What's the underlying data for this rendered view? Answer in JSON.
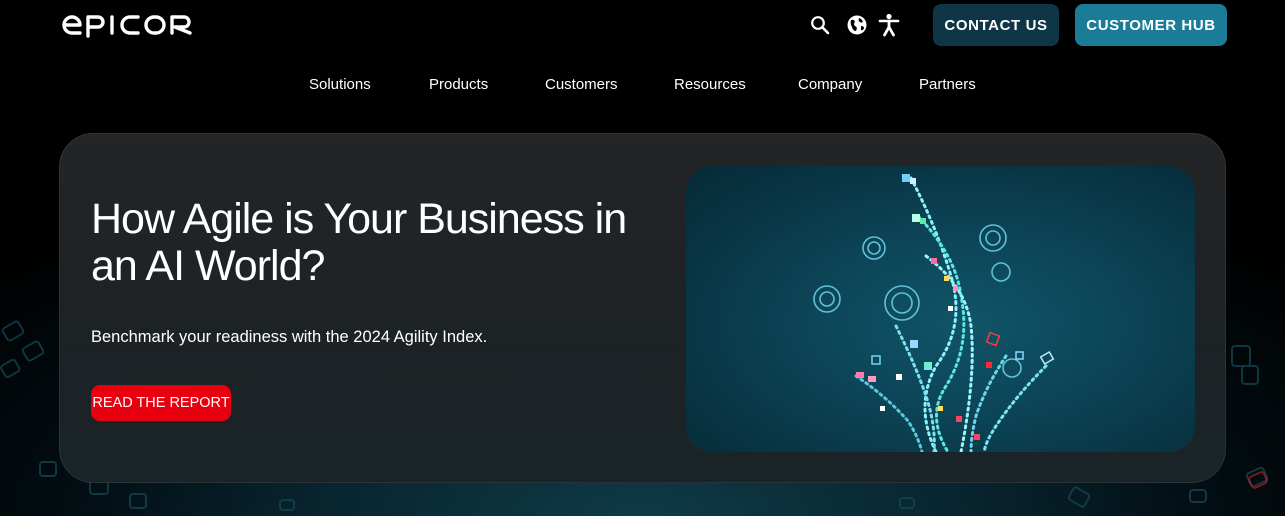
{
  "header": {
    "logo_text": "EPICOR",
    "icons": {
      "search": "search-icon",
      "language": "globe-icon",
      "accessibility": "accessibility-icon"
    },
    "contact_label": "CONTACT US",
    "hub_label": "CUSTOMER HUB"
  },
  "nav": {
    "items": [
      {
        "label": "Solutions"
      },
      {
        "label": "Products"
      },
      {
        "label": "Customers"
      },
      {
        "label": "Resources"
      },
      {
        "label": "Company"
      },
      {
        "label": "Partners"
      }
    ]
  },
  "hero": {
    "title": "How Agile is Your Business in an AI World?",
    "subtitle": "Benchmark your readiness with the 2024 Agility Index.",
    "cta_label": "READ THE REPORT",
    "image": "abstract-data-tree-illustration"
  },
  "colors": {
    "background": "#000000",
    "contact_button": "#0f3647",
    "hub_button": "#1b7c97",
    "cta_button": "#e8000e",
    "card": "#1f2326",
    "image_bg": "#0c4557"
  }
}
